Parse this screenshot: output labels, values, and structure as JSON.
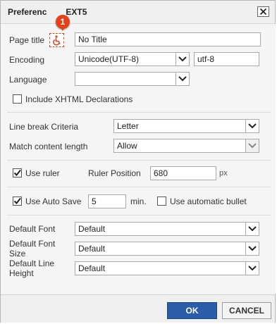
{
  "dialog": {
    "title_start": "Preferenc",
    "title_end": "EXT5",
    "badge": "1"
  },
  "page_title": {
    "label": "Page title",
    "value": "No Title"
  },
  "encoding": {
    "label": "Encoding",
    "selected": "Unicode(UTF-8)",
    "value": "utf-8"
  },
  "language": {
    "label": "Language",
    "selected": ""
  },
  "xhtml": {
    "label": "Include XHTML Declarations",
    "checked": false
  },
  "line_break": {
    "label": "Line break Criteria",
    "selected": "Letter"
  },
  "match_length": {
    "label": "Match content length",
    "selected": "Allow"
  },
  "ruler": {
    "label": "Use ruler",
    "checked": true,
    "position_label": "Ruler Position",
    "position_value": "680",
    "unit": "px"
  },
  "auto_save": {
    "label": "Use Auto Save",
    "checked": true,
    "value": "5",
    "unit": "min."
  },
  "auto_bullet": {
    "label": "Use automatic bullet",
    "checked": false
  },
  "default_font": {
    "label": "Default Font",
    "selected": "Default"
  },
  "default_font_size": {
    "label_line1": "Default Font",
    "label_line2": "Size",
    "selected": "Default"
  },
  "default_line_height": {
    "label_line1": "Default Line",
    "label_line2": "Height",
    "selected": "Default"
  },
  "footer": {
    "ok_label": "OK",
    "cancel_label": "CANCEL"
  },
  "colors": {
    "accent": "#2b5ca8",
    "badge": "#e0431c"
  }
}
